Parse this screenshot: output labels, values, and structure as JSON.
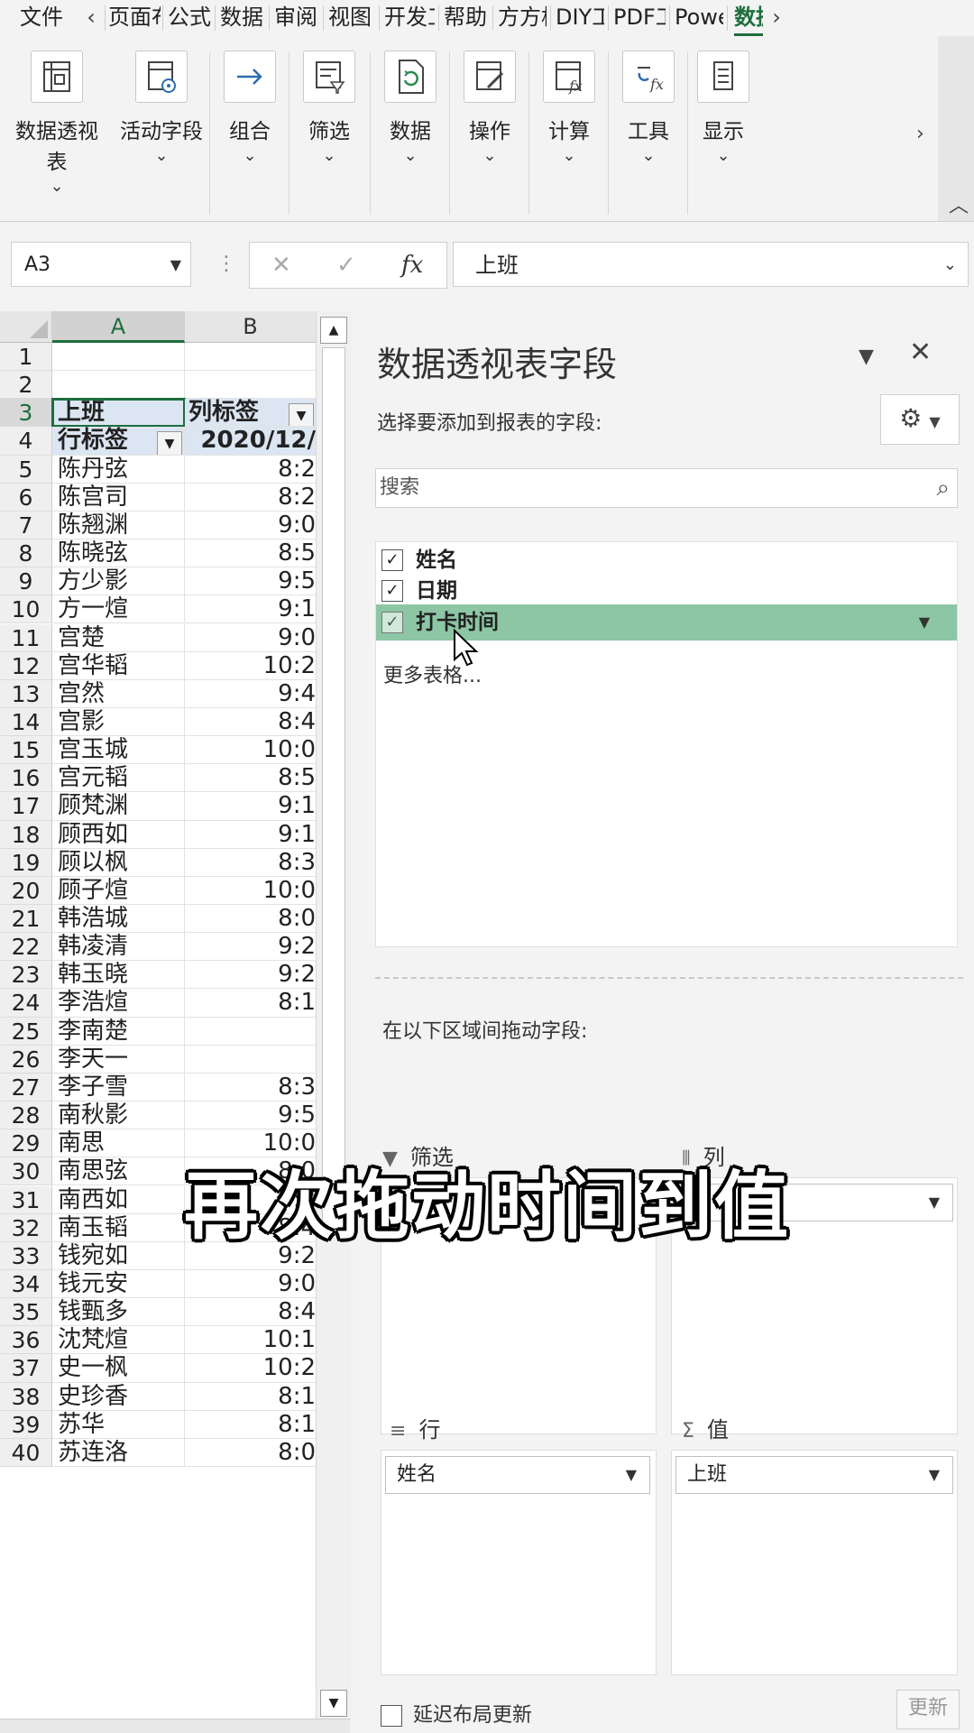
{
  "ribbon_tabs": [
    "文件",
    "页面布",
    "公式",
    "数据",
    "审阅",
    "视图",
    "开发工",
    "帮助",
    "方方格",
    "DIY工",
    "PDF工",
    "Powe",
    "数据"
  ],
  "ribbon_tab_arrows": {
    "left": "‹",
    "right": "›"
  },
  "ribbon_groups": [
    {
      "label": "数据透视表",
      "icon": "pivot-table-icon"
    },
    {
      "label": "活动字段",
      "icon": "active-field-icon"
    },
    {
      "label": "组合",
      "icon": "group-arrow-icon"
    },
    {
      "label": "筛选",
      "icon": "filter-icon"
    },
    {
      "label": "数据",
      "icon": "refresh-data-icon"
    },
    {
      "label": "操作",
      "icon": "actions-icon"
    },
    {
      "label": "计算",
      "icon": "calculation-icon"
    },
    {
      "label": "工具",
      "icon": "tools-icon"
    },
    {
      "label": "显示",
      "icon": "show-icon"
    }
  ],
  "formula_bar": {
    "name_box": "A3",
    "dots": "⋮",
    "cancel": "✕",
    "enter": "✓",
    "fx": "fx",
    "value": "上班"
  },
  "grid": {
    "columns": [
      "A",
      "B"
    ],
    "rows": [
      {
        "n": "1",
        "a": "",
        "b": ""
      },
      {
        "n": "2",
        "a": "",
        "b": ""
      },
      {
        "n": "3",
        "a": "上班",
        "b": "列标签"
      },
      {
        "n": "4",
        "a": "行标签",
        "b": "2020/12/"
      },
      {
        "n": "5",
        "a": "陈丹弦",
        "b": "8:2"
      },
      {
        "n": "6",
        "a": "陈宫司",
        "b": "8:2"
      },
      {
        "n": "7",
        "a": "陈翘渊",
        "b": "9:0"
      },
      {
        "n": "8",
        "a": "陈晓弦",
        "b": "8:5"
      },
      {
        "n": "9",
        "a": "方少影",
        "b": "9:5"
      },
      {
        "n": "10",
        "a": "方一煊",
        "b": "9:1"
      },
      {
        "n": "11",
        "a": "宫楚",
        "b": "9:0"
      },
      {
        "n": "12",
        "a": "宫华韬",
        "b": "10:2"
      },
      {
        "n": "13",
        "a": "宫然",
        "b": "9:4"
      },
      {
        "n": "14",
        "a": "宫影",
        "b": "8:4"
      },
      {
        "n": "15",
        "a": "宫玉城",
        "b": "10:0"
      },
      {
        "n": "16",
        "a": "宫元韬",
        "b": "8:5"
      },
      {
        "n": "17",
        "a": "顾梵渊",
        "b": "9:1"
      },
      {
        "n": "18",
        "a": "顾西如",
        "b": "9:1"
      },
      {
        "n": "19",
        "a": "顾以枫",
        "b": "8:3"
      },
      {
        "n": "20",
        "a": "顾子煊",
        "b": "10:0"
      },
      {
        "n": "21",
        "a": "韩浩城",
        "b": "8:0"
      },
      {
        "n": "22",
        "a": "韩凌清",
        "b": "9:2"
      },
      {
        "n": "23",
        "a": "韩玉晓",
        "b": "9:2"
      },
      {
        "n": "24",
        "a": "李浩煊",
        "b": "8:1"
      },
      {
        "n": "25",
        "a": "李南楚",
        "b": ""
      },
      {
        "n": "26",
        "a": "李天一",
        "b": ""
      },
      {
        "n": "27",
        "a": "李子雪",
        "b": "8:3"
      },
      {
        "n": "28",
        "a": "南秋影",
        "b": "9:5"
      },
      {
        "n": "29",
        "a": "南思",
        "b": "10:0"
      },
      {
        "n": "30",
        "a": "南思弦",
        "b": "8:0"
      },
      {
        "n": "31",
        "a": "南西如",
        "b": "9:3"
      },
      {
        "n": "32",
        "a": "南玉韬",
        "b": "8:4"
      },
      {
        "n": "33",
        "a": "钱宛如",
        "b": "9:2"
      },
      {
        "n": "34",
        "a": "钱元安",
        "b": "9:0"
      },
      {
        "n": "35",
        "a": "钱甄多",
        "b": "8:4"
      },
      {
        "n": "36",
        "a": "沈梵煊",
        "b": "10:1"
      },
      {
        "n": "37",
        "a": "史一枫",
        "b": "10:2"
      },
      {
        "n": "38",
        "a": "史珍香",
        "b": "8:1"
      },
      {
        "n": "39",
        "a": "苏华",
        "b": "8:1"
      },
      {
        "n": "40",
        "a": "苏连洛",
        "b": "8:0"
      }
    ]
  },
  "pivot_pane": {
    "title": "数据透视表字段",
    "subtitle": "选择要添加到报表的字段:",
    "search_placeholder": "搜索",
    "fields": [
      {
        "label": "姓名",
        "checked": true
      },
      {
        "label": "日期",
        "checked": true
      },
      {
        "label": "打卡时间",
        "checked": true
      }
    ],
    "more_tables": "更多表格...",
    "drag_label": "在以下区域间拖动字段:",
    "zones": {
      "filter": {
        "label": "筛选"
      },
      "columns": {
        "label": "列"
      },
      "rows": {
        "label": "行",
        "chip": "姓名"
      },
      "values": {
        "label": "值",
        "chip": "上班"
      }
    },
    "defer_update": "延迟布局更新",
    "update_button": "更新"
  },
  "caption": "再次拖动时间到值"
}
